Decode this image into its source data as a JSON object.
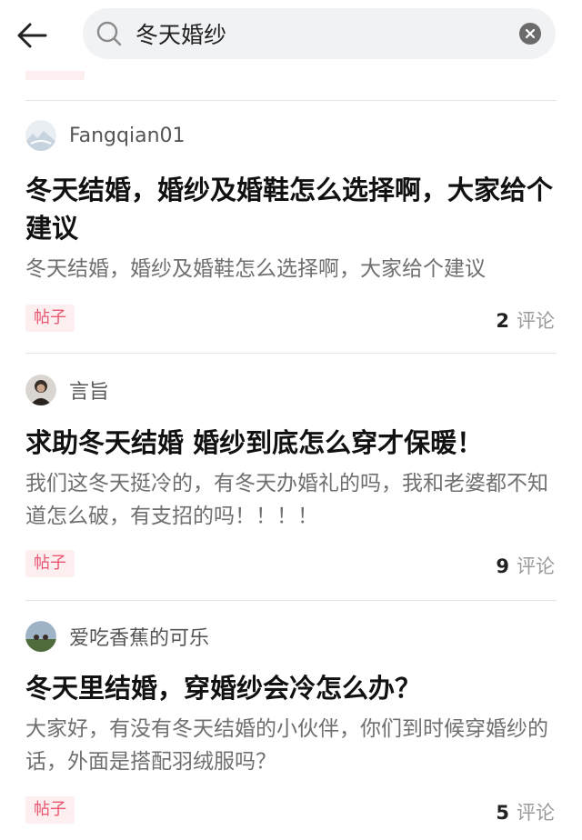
{
  "search": {
    "query": "冬天婚纱"
  },
  "icons": {
    "back": "arrow-left-icon",
    "search": "search-icon",
    "clear": "clear-circle-icon"
  },
  "colors": {
    "tag_bg": "#fdeef0",
    "tag_text": "#e8566f",
    "search_bg": "#f1f2f4",
    "divider": "#e6e6e6"
  },
  "posts": [
    {
      "author": "Fangqian01",
      "title": "冬天结婚，婚纱及婚鞋怎么选择啊，大家给个建议",
      "summary": "冬天结婚，婚纱及婚鞋怎么选择啊，大家给个建议",
      "tag": "帖子",
      "comment_count": "2",
      "comment_label": "评论"
    },
    {
      "author": "言旨",
      "title": "求助冬天结婚 婚纱到底怎么穿才保暖！",
      "summary": " 我们这冬天挺冷的，有冬天办婚礼的吗，我和老婆都不知道怎么破，有支招的吗！！！！",
      "tag": "帖子",
      "comment_count": "9",
      "comment_label": "评论"
    },
    {
      "author": "爱吃香蕉的可乐",
      "title": "冬天里结婚，穿婚纱会冷怎么办？",
      "summary": "大家好，有没有冬天结婚的小伙伴，你们到时候穿婚纱的话，外面是搭配羽绒服吗？",
      "tag": "帖子",
      "comment_count": "5",
      "comment_label": "评论"
    }
  ]
}
